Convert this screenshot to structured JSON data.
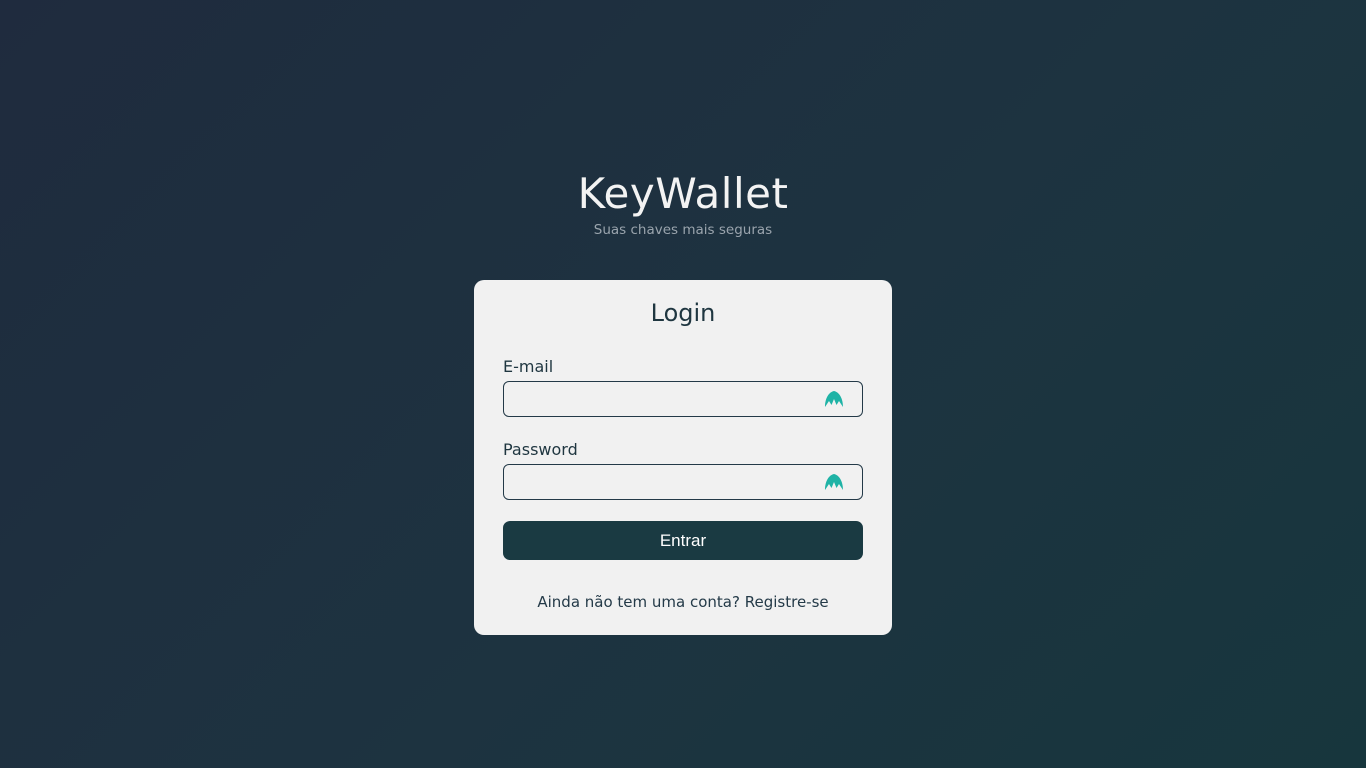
{
  "brand": {
    "title": "KeyWallet",
    "subtitle": "Suas chaves mais seguras"
  },
  "login_card": {
    "title": "Login",
    "email": {
      "label": "E-mail",
      "value": "",
      "placeholder": "",
      "icon": "password-manager-icon"
    },
    "password": {
      "label": "Password",
      "value": "",
      "placeholder": "",
      "icon": "password-manager-icon"
    },
    "submit_label": "Entrar",
    "register_prompt": "Ainda não tem uma conta?",
    "register_link": "Registre-se"
  },
  "colors": {
    "background_start": "#1f2b3e",
    "background_end": "#17363d",
    "card_background": "#f1f1f1",
    "primary_button": "#1a3a42",
    "icon_accent": "#1fb3a6"
  }
}
